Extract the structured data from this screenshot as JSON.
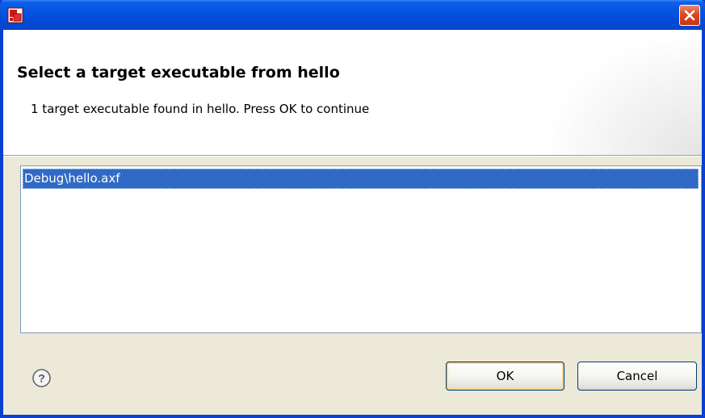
{
  "window": {
    "title": "",
    "close_label": "Close"
  },
  "header": {
    "title": "Select a target executable from hello",
    "message": "1 target executable found in hello. Press OK to continue"
  },
  "list": {
    "items": [
      {
        "label": "Debug\\hello.axf",
        "selected": true
      }
    ]
  },
  "buttons": {
    "ok": "OK",
    "cancel": "Cancel"
  },
  "colors": {
    "titlebar": "#0453e0",
    "selection": "#316ac5",
    "close": "#d9481f"
  },
  "icons": {
    "app": "application-icon",
    "close": "close-icon",
    "help": "help-icon"
  }
}
